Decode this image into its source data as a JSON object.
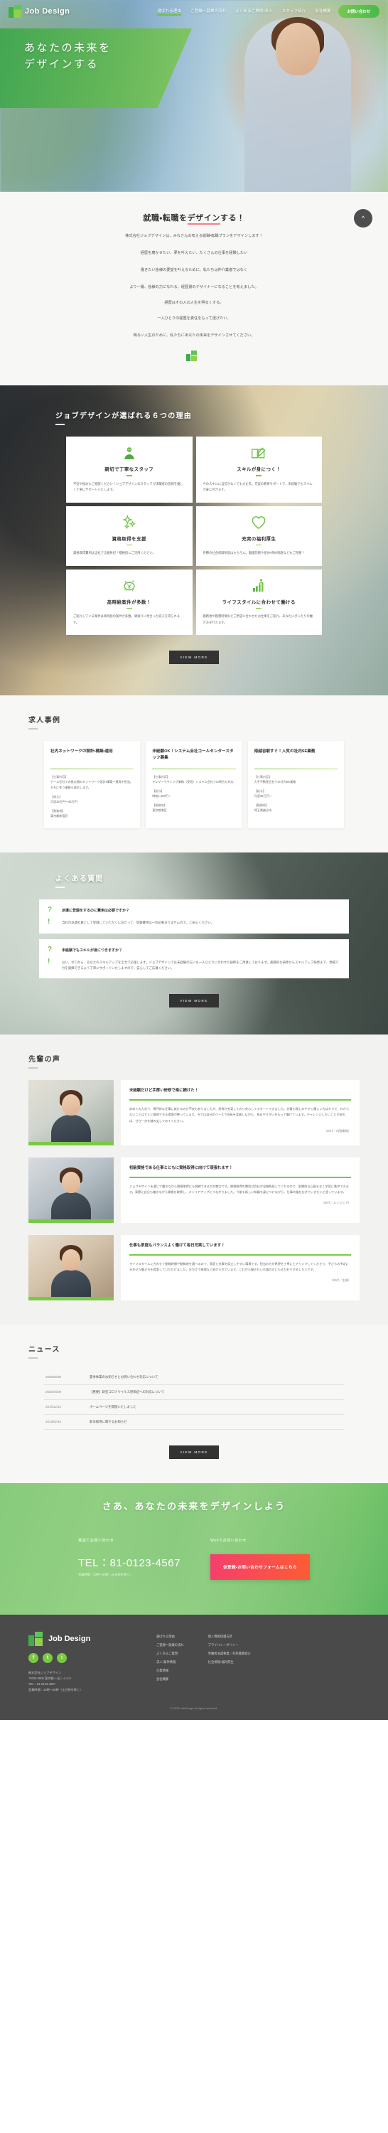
{
  "nav": {
    "logo_text": "Job Design",
    "links": [
      {
        "label": "選ばれる理由",
        "active": true
      },
      {
        "label": "ご登録～就業の流れ",
        "active": false
      },
      {
        "label": "よくあるご質問・求人",
        "active": false
      },
      {
        "label": "スタッフ紹介",
        "active": false
      },
      {
        "label": "会社概要",
        "active": false
      }
    ],
    "cta_label": "お問い合わせ"
  },
  "hero": {
    "line1": "あなたの未来を",
    "line2": "デザインする"
  },
  "intro": {
    "heading_before": "就職・転職を",
    "heading_mark": "デザイン",
    "heading_after": "する！",
    "paragraph1": "株式会社ジョブデザインは、みなさんの考える就職・転職プランをデザインします！",
    "paragraph2": "経歴を磨かせたい、夢を叶えたい、たくさんの仕事を経験したい",
    "paragraph3": "働きたい皆様の要望を叶えるために、私たちは仲介業者ではなく",
    "paragraph4": "より一層、皆様の力になれる、経歴書のデザイナーになることを考えました。",
    "paragraph5": "経歴はその人の人生を明るくする。",
    "paragraph6": "一人ひとりの経歴を責任をもって選びたい、",
    "paragraph7": "明るい人生のために、私たちにあなたの未来をデザインさせてください。",
    "scroll_icon": "chevron-up-icon"
  },
  "reasons": {
    "heading": "ジョブデザインが選ばれる６つの理由",
    "cards": [
      {
        "icon": "staff-person-icon",
        "title": "親切で丁寧なスタッフ",
        "body": "不安や悩みもご相談ください！ジョブデザインのスタッフが求職者の皆様を優しく丁寧にサポートいたします。"
      },
      {
        "icon": "book-pencil-icon",
        "title": "スキルが身につく！",
        "body": "今のスキルに自信がなくても大丈夫。充実の教育サポートで、未経験でもスキルが身に付きます。"
      },
      {
        "icon": "sparkle-icon",
        "title": "資格取得を支援",
        "body": "資格取得費用は当社で全額負担！積極的にご活用ください。"
      },
      {
        "icon": "heart-icon",
        "title": "充実の福利厚生",
        "body": "各種の社会保険制度はもちろん。健康診断や産休・育休制度などもご用意！"
      },
      {
        "icon": "coin-yen-icon",
        "title": "高時給案件が多数！",
        "body": "ご紹介している案件は高時給の案件が多数。頑張りに見合った収入を得られます。"
      },
      {
        "icon": "career-growth-icon",
        "title": "ライフスタイルに合わせて働ける",
        "body": "勤務地や勤務時間などご希望に合わせたお仕事をご紹介。あなたにぴったりの働き方を叶えます。"
      }
    ],
    "view_more": "VIEW MORE"
  },
  "jobs": {
    "heading": "求人事例",
    "cards": [
      {
        "title": "社内ネットワークの設計・構築・運用",
        "desc_label": "【仕事内容】",
        "desc": "ゲーム会社での拠点間のネットワーク設計・構築～運用を担当。それに伴う業務も発生します。",
        "salary_label": "【給与】",
        "salary": "月収35万円～45万円",
        "place_label": "【勤務地】",
        "place": "東京都新宿区"
      },
      {
        "title": "未経験OK！システム会社コールセンタースタッフ募集",
        "desc_label": "【仕事内容】",
        "desc": "テレマーケティング業務（受信）システム会社での問合せ対応",
        "salary_label": "【給与】",
        "salary": "時給1,400円～",
        "place_label": "【勤務地】",
        "place": "東京都港区"
      },
      {
        "title": "南越谷駅すぐ！人気の社内SE業務",
        "desc_label": "【仕事内容】",
        "desc": "大手不動産会社での社内SE業務",
        "salary_label": "【給与】",
        "salary": "月収28万円～",
        "place_label": "【勤務地】",
        "place": "埼玉県越谷市"
      }
    ]
  },
  "faq": {
    "heading": "よくある質問",
    "items": [
      {
        "q_mark": "?",
        "a_mark": "!",
        "question": "派遣に登録をするのに費用は必要ですか？",
        "answer": "当社の派遣社員として登録していただくにあたって、登録費用は一切必要ありませんので、ご安心ください。"
      },
      {
        "q_mark": "?",
        "a_mark": "!",
        "question": "未経験でもスキルが身につきますか？",
        "answer": "はい。ゼロから、あなたのスキルアップを全力で応援します。ジョブデザインでは未経験の方にも一人ひとりに合わせた研修をご用意しております。基礎的な研修からスキルアップ研修まで、現場で力を発揮できるよう丁寧にサポートいたしますので、安心してご応募ください。"
      }
    ],
    "view_more": "VIEW MORE"
  },
  "voice": {
    "heading": "先輩の声",
    "items": [
      {
        "photo": "portrait-female-office",
        "title": "未経験だけど手厚い研修で楽に続けた！",
        "body": "初めての入社で、専門的な仕事に就けるのか不安もありましたが、研修が充実しており安心してスタートできました。先輩も親しみやすく優しい方ばかりで、わからないことはすぐに質問できる環境が整っています。今では自分のペースで成長を実感しながら、毎日やりがいをもって働けています。チャレンジしたいことがあれば、ぜひ一歩を踏み出してみてください。",
        "meta": "（20代／内勤業務）"
      },
      {
        "photo": "portrait-male-office",
        "title": "初級資格である仕事とともに資格取得に向けて頑張れます！",
        "body": "ジョブデザインを通じて働きながら資格取得にも挑戦できるのが魅力です。資格取得の費用は会社が全額負担してくれるので、金銭的な心配もなく学習に集中できます。実際に自分も働きながら資格を取得し、キャリアアップにつながりました。今後も新しい知識を身につけながら、仕事の幅を広げていきたいと思っています。",
        "meta": "（30代／エンジニア）"
      },
      {
        "photo": "portrait-female-cafe",
        "title": "仕事も家庭もバランスよく働けて毎日充実しています！",
        "body": "ライフスタイルに合わせて勤務時間や勤務地を選べるので、家庭と仕事を両立しやすい環境です。担当の方が希望を丁寧にヒアリングしてくださり、子どもの予定に合わせた働き方を提案していただけました。おかげで無理なく続けられています。これから働きたい主婦の方にもぜひおすすめしたいです。",
        "meta": "（30代／主婦）"
      }
    ]
  },
  "news": {
    "heading": "ニュース",
    "items": [
      {
        "date": "2025/06/30",
        "title": "夏季休業のお知らせとお問い合わせ対応について"
      },
      {
        "date": "2025/04/08",
        "title": "【重要】新型コロナウイルス感染症への対応について"
      },
      {
        "date": "2019/12/12",
        "title": "ホームページを開設いたしました"
      },
      {
        "date": "2019/02/10",
        "title": "新卒採用に関するお知らせ"
      }
    ],
    "view_more": "VIEW MORE"
  },
  "cta": {
    "heading": "さあ、あなたの未来をデザインしよう",
    "tel_label": "電話でお問い合わせ",
    "tel_number": "TEL：81-0123-4567",
    "hours": "営業時間：10時～20時（土日祝を除く）",
    "web_label": "Webでお問い合わせ",
    "button": "仮登録・お問い合わせフォームはこちら"
  },
  "footer": {
    "logo_text": "Job Design",
    "social": [
      {
        "name": "facebook-icon",
        "glyph": "f"
      },
      {
        "name": "twitter-icon",
        "glyph": "t"
      },
      {
        "name": "instagram-icon",
        "glyph": "i"
      }
    ],
    "company": "株式会社ジョブデザイン",
    "address": "〒000-0000 東京都○○区○○1-2-3",
    "tel": "TEL：81-0123-4567",
    "hours": "営業時間：10時～20時（土日祝を除く）",
    "columns": [
      [
        {
          "label": "選ばれる理由"
        },
        {
          "label": "ご登録～就業の流れ"
        },
        {
          "label": "よくあるご質問"
        },
        {
          "label": "求人・案件情報"
        },
        {
          "label": "企業情報"
        },
        {
          "label": "会社概要"
        }
      ],
      [
        {
          "label": "個人情報保護方針"
        },
        {
          "label": "プライバシーポリシー"
        },
        {
          "label": "労働者派遣事業／有料職業紹介"
        },
        {
          "label": "社会保険・福利厚生"
        }
      ]
    ],
    "copyright": "© 2025 JobDesign all rights reserved."
  }
}
